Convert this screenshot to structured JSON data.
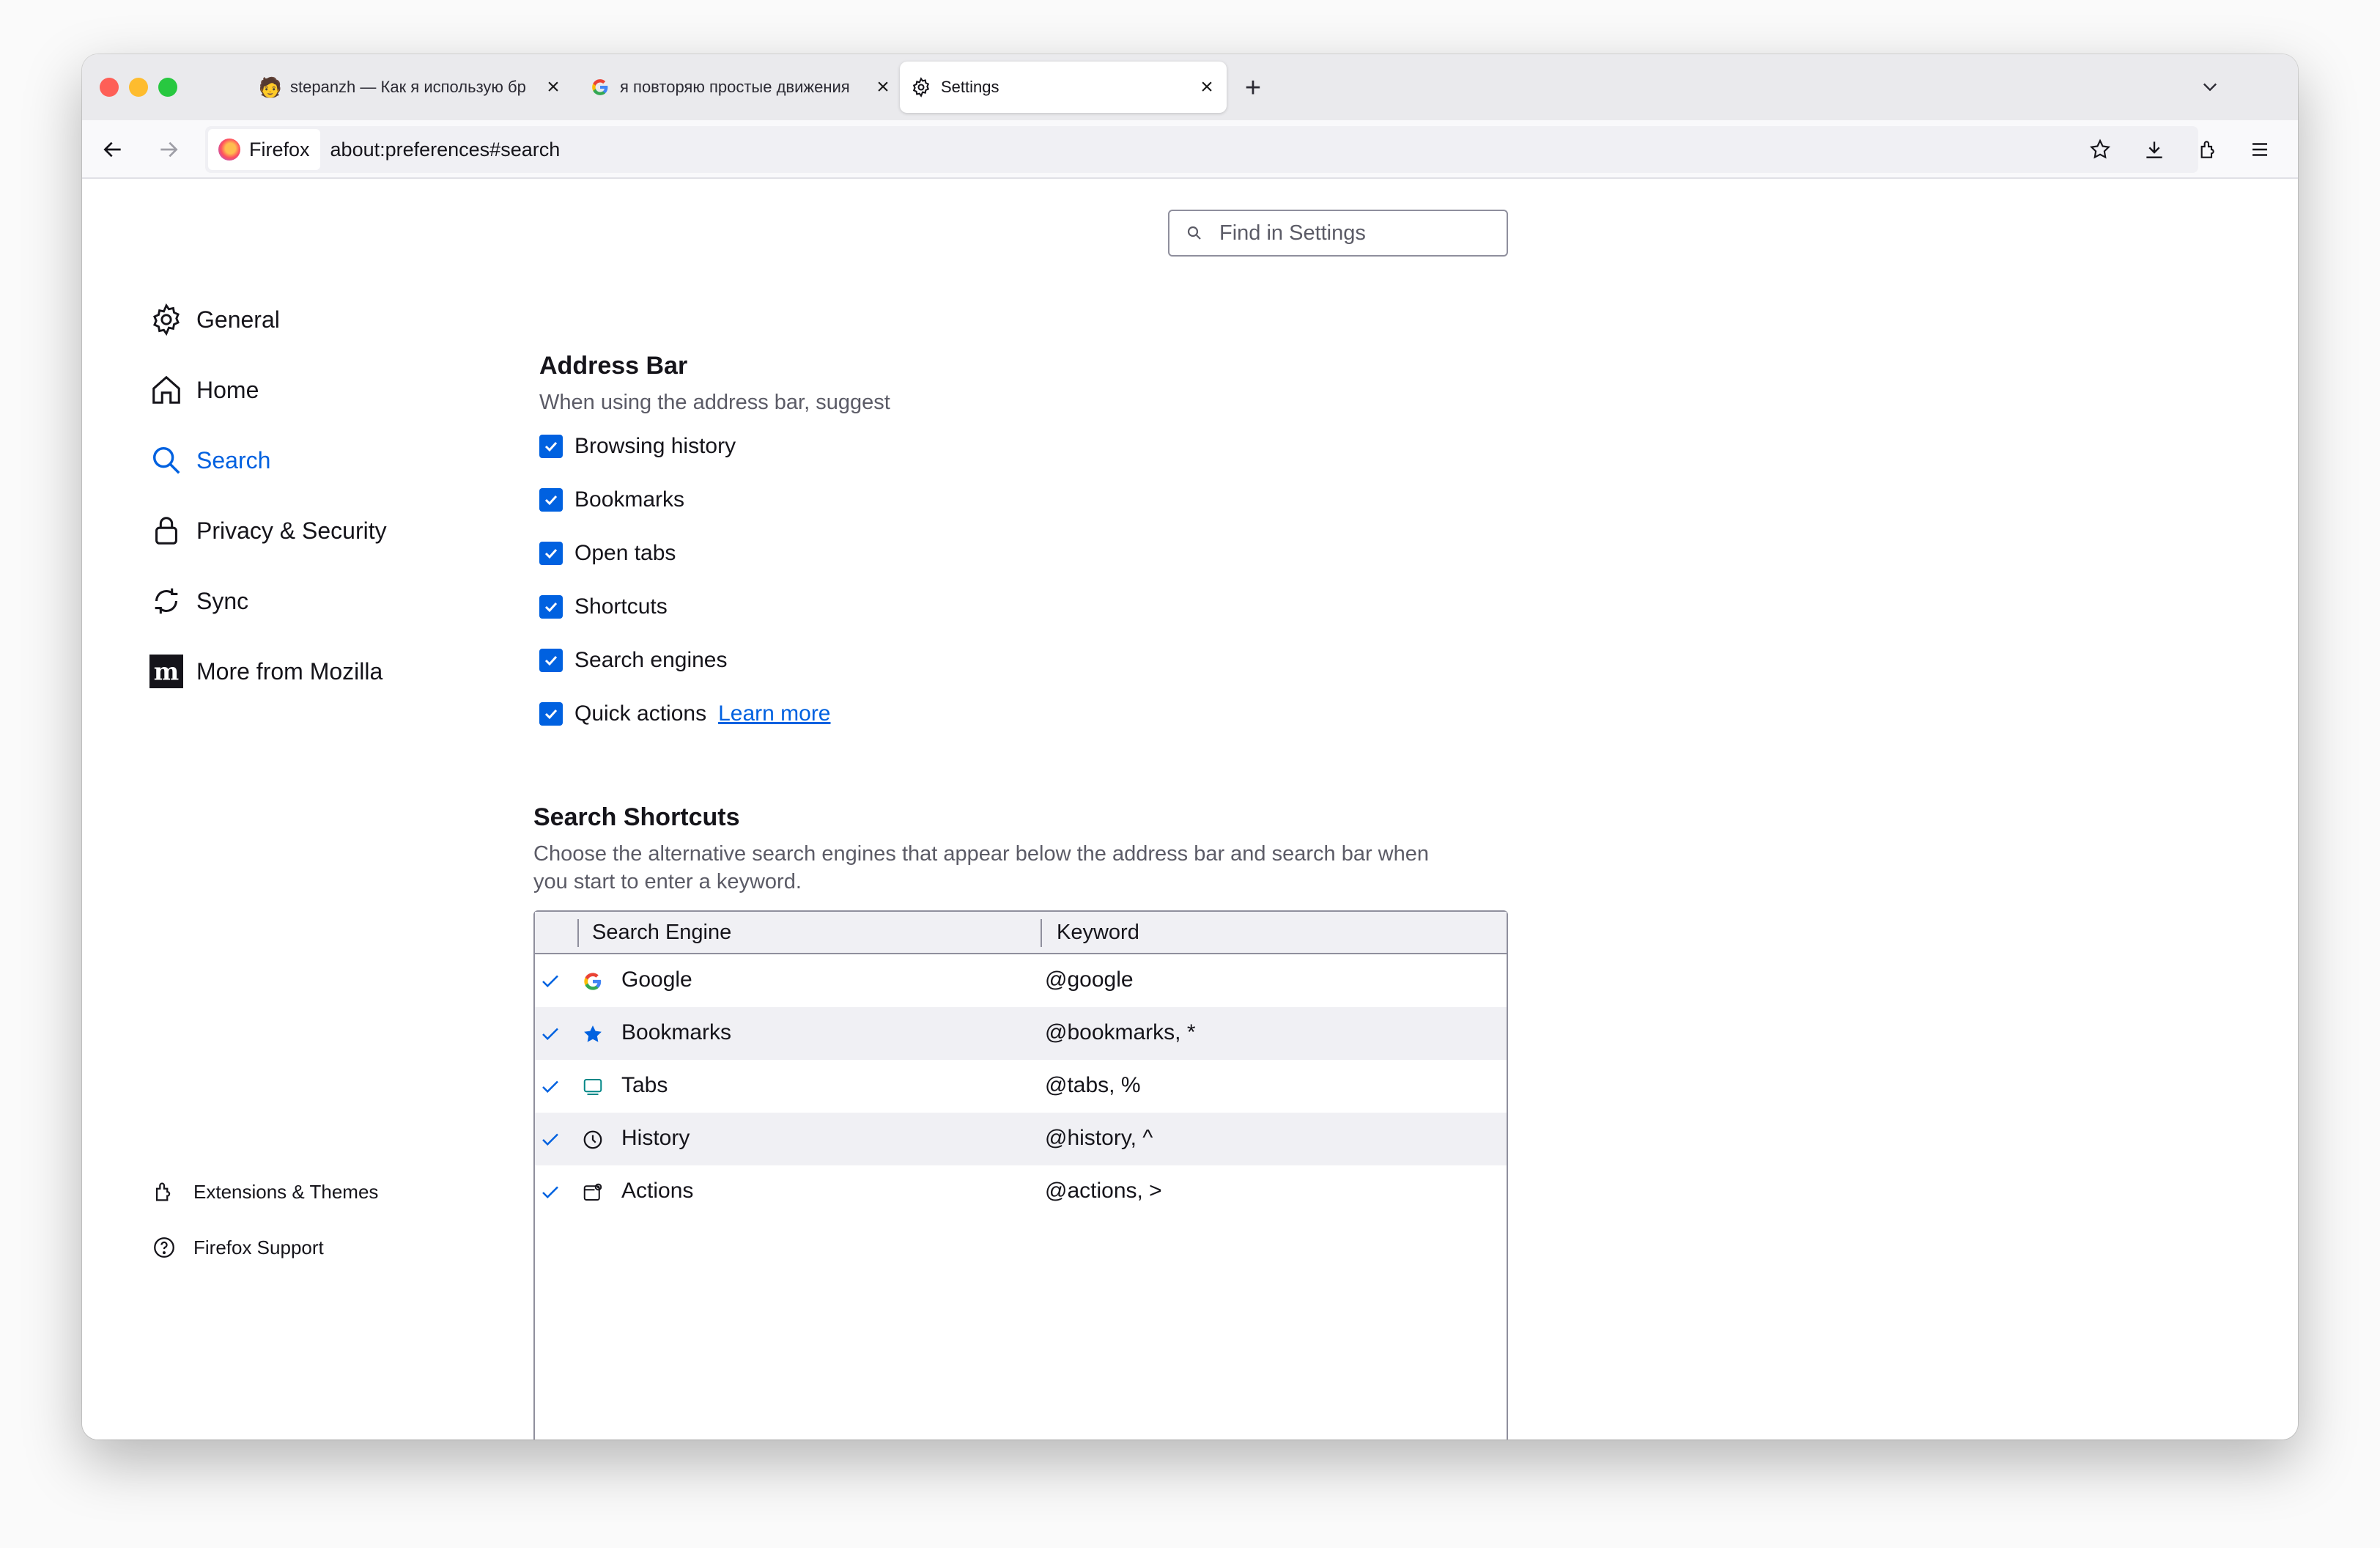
{
  "browser": {
    "tabs": [
      {
        "title": "stepanzh — Как я использую бр",
        "icon": "person-emoji-icon",
        "active": false
      },
      {
        "title": "я повторяю простые движения",
        "icon": "google-g-icon",
        "active": false
      },
      {
        "title": "Settings",
        "icon": "gear-icon",
        "active": true
      }
    ],
    "identity_label": "Firefox",
    "url": "about:preferences#search"
  },
  "search_settings": {
    "placeholder": "Find in Settings"
  },
  "sidebar": {
    "items": [
      {
        "label": "General",
        "icon": "gear-icon"
      },
      {
        "label": "Home",
        "icon": "home-icon"
      },
      {
        "label": "Search",
        "icon": "search-icon",
        "active": true
      },
      {
        "label": "Privacy & Security",
        "icon": "lock-icon"
      },
      {
        "label": "Sync",
        "icon": "sync-icon"
      },
      {
        "label": "More from Mozilla",
        "icon": "mozilla-logo-icon"
      }
    ],
    "footer": [
      {
        "label": "Extensions & Themes",
        "icon": "puzzle-icon"
      },
      {
        "label": "Firefox Support",
        "icon": "help-icon"
      }
    ]
  },
  "address_bar": {
    "title": "Address Bar",
    "description": "When using the address bar, suggest",
    "options": [
      {
        "label": "Browsing history",
        "checked": true
      },
      {
        "label": "Bookmarks",
        "checked": true
      },
      {
        "label": "Open tabs",
        "checked": true
      },
      {
        "label": "Shortcuts",
        "checked": true
      },
      {
        "label": "Search engines",
        "checked": true
      },
      {
        "label": "Quick actions",
        "checked": true
      }
    ],
    "learn_more": "Learn more"
  },
  "search_shortcuts": {
    "title": "Search Shortcuts",
    "description_line1": "Choose the alternative search engines that appear below the address bar and search bar when",
    "description_line2": "you start to enter a keyword.",
    "columns": [
      "Search Engine",
      "Keyword"
    ],
    "rows": [
      {
        "name": "Google",
        "keyword": "@google",
        "icon": "google-g-icon",
        "checked": true
      },
      {
        "name": "Bookmarks",
        "keyword": "@bookmarks, *",
        "icon": "star-icon",
        "checked": true
      },
      {
        "name": "Tabs",
        "keyword": "@tabs, %",
        "icon": "tab-icon",
        "checked": true
      },
      {
        "name": "History",
        "keyword": "@history, ^",
        "icon": "clock-icon",
        "checked": true
      },
      {
        "name": "Actions",
        "keyword": "@actions, >",
        "icon": "actions-icon",
        "checked": true
      }
    ]
  },
  "colors": {
    "accent": "#0061e0",
    "tab_strip": "#eaeaed",
    "row_alt": "#f0f0f4"
  }
}
